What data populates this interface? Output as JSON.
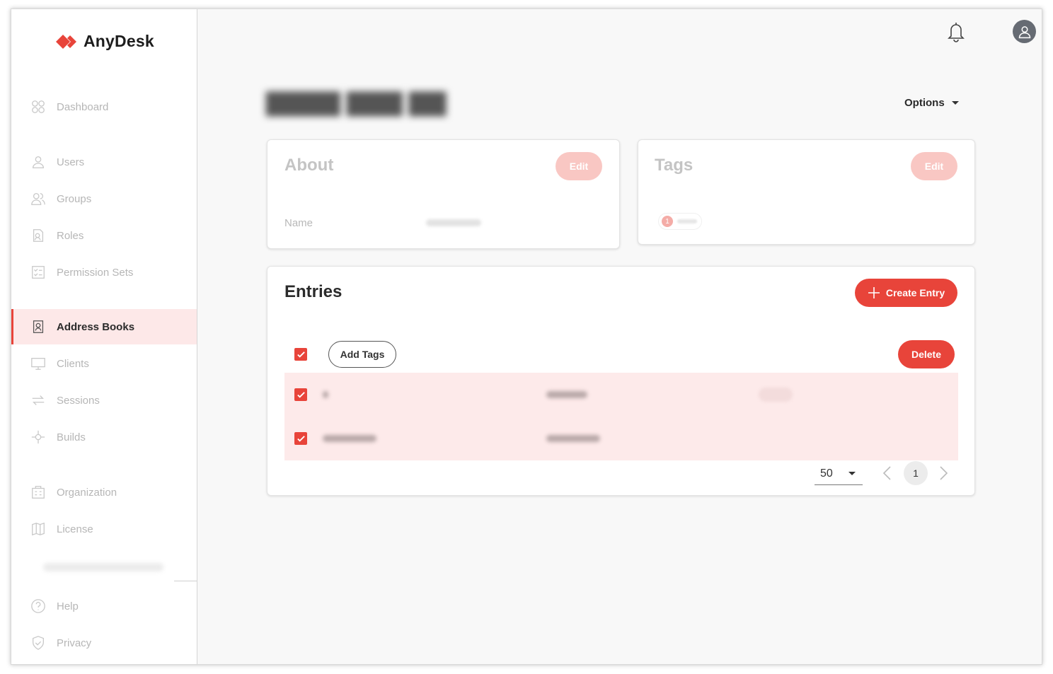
{
  "app": {
    "name": "AnyDesk",
    "brand_color": "#e8443a"
  },
  "sidebar": {
    "items": [
      {
        "label": "Dashboard",
        "icon": "dashboard-icon"
      },
      {
        "label": "Users",
        "icon": "user-icon"
      },
      {
        "label": "Groups",
        "icon": "groups-icon"
      },
      {
        "label": "Roles",
        "icon": "roles-icon"
      },
      {
        "label": "Permission Sets",
        "icon": "permission-sets-icon"
      },
      {
        "label": "Address Books",
        "icon": "address-book-icon",
        "active": true
      },
      {
        "label": "Clients",
        "icon": "monitor-icon"
      },
      {
        "label": "Sessions",
        "icon": "sessions-icon"
      },
      {
        "label": "Builds",
        "icon": "builds-icon"
      },
      {
        "label": "Organization",
        "icon": "organization-icon"
      },
      {
        "label": "License",
        "icon": "license-icon"
      },
      {
        "label": "Help",
        "icon": "help-icon"
      },
      {
        "label": "Privacy",
        "icon": "shield-icon"
      }
    ]
  },
  "header": {
    "options_label": "Options"
  },
  "about": {
    "title": "About",
    "edit_label": "Edit",
    "name_label": "Name"
  },
  "tags": {
    "title": "Tags",
    "edit_label": "Edit",
    "tag_count": "1"
  },
  "entries": {
    "title": "Entries",
    "create_label": "Create Entry",
    "add_tags_label": "Add Tags",
    "delete_label": "Delete",
    "per_page": "50",
    "current_page": "1"
  }
}
